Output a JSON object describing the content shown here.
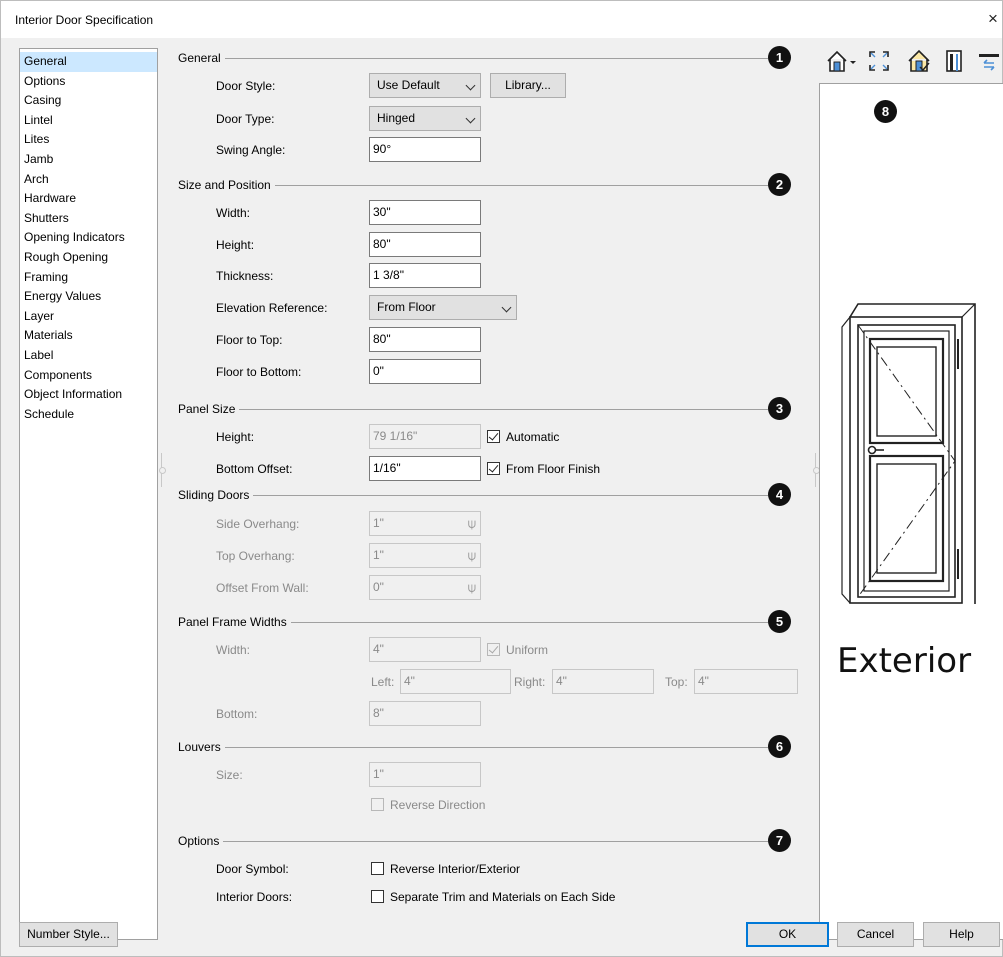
{
  "window": {
    "title": "Interior Door Specification",
    "close_glyph": "×"
  },
  "nav": {
    "items": [
      "General",
      "Options",
      "Casing",
      "Lintel",
      "Lites",
      "Jamb",
      "Arch",
      "Hardware",
      "Shutters",
      "Opening Indicators",
      "Rough Opening",
      "Framing",
      "Energy Values",
      "Layer",
      "Materials",
      "Label",
      "Components",
      "Object Information",
      "Schedule"
    ],
    "selected": "General"
  },
  "general": {
    "title": "General",
    "badge": "1",
    "door_style_label": "Door Style:",
    "door_style_value": "Use Default",
    "library_button": "Library...",
    "door_type_label": "Door Type:",
    "door_type_value": "Hinged",
    "swing_angle_label": "Swing Angle:",
    "swing_angle_value": "90°"
  },
  "size_position": {
    "title": "Size and Position",
    "badge": "2",
    "width_label": "Width:",
    "width_value": "30\"",
    "height_label": "Height:",
    "height_value": "80\"",
    "thickness_label": "Thickness:",
    "thickness_value": "1 3/8\"",
    "elevation_label": "Elevation Reference:",
    "elevation_value": "From Floor",
    "floor_top_label": "Floor to Top:",
    "floor_top_value": "80\"",
    "floor_bottom_label": "Floor to Bottom:",
    "floor_bottom_value": "0\""
  },
  "panel_size": {
    "title": "Panel Size",
    "badge": "3",
    "height_label": "Height:",
    "height_value": "79 1/16\"",
    "automatic_label": "Automatic",
    "automatic_checked": true,
    "bottom_offset_label": "Bottom Offset:",
    "bottom_offset_value": "1/16\"",
    "from_floor_finish_label": "From Floor Finish",
    "from_floor_finish_checked": true
  },
  "sliding_doors": {
    "title": "Sliding Doors",
    "badge": "4",
    "side_overhang_label": "Side Overhang:",
    "side_overhang_value": "1\"",
    "top_overhang_label": "Top Overhang:",
    "top_overhang_value": "1\"",
    "offset_wall_label": "Offset From Wall:",
    "offset_wall_value": "0\""
  },
  "panel_frame_widths": {
    "title": "Panel Frame Widths",
    "badge": "5",
    "width_label": "Width:",
    "width_value": "4\"",
    "uniform_label": "Uniform",
    "uniform_checked": true,
    "left_label": "Left:",
    "left_value": "4\"",
    "right_label": "Right:",
    "right_value": "4\"",
    "top_label": "Top:",
    "top_value": "4\"",
    "bottom_label": "Bottom:",
    "bottom_value": "8\""
  },
  "louvers": {
    "title": "Louvers",
    "badge": "6",
    "size_label": "Size:",
    "size_value": "1\"",
    "reverse_direction_label": "Reverse Direction",
    "reverse_direction_checked": false
  },
  "options": {
    "title": "Options",
    "badge": "7",
    "door_symbol_label": "Door Symbol:",
    "reverse_label": "Reverse Interior/Exterior",
    "reverse_checked": false,
    "interior_doors_label": "Interior Doors:",
    "separate_trim_label": "Separate Trim and Materials on Each Side",
    "separate_trim_checked": false
  },
  "preview": {
    "badge": "8",
    "side_label": "Exterior"
  },
  "footer": {
    "number_style_button": "Number Style...",
    "ok_button": "OK",
    "cancel_button": "Cancel",
    "help_button": "Help"
  },
  "icons": {
    "view_dropdown": "house-view-dropdown-icon",
    "fill_window": "fill-window-icon",
    "render_options": "house-render-icon",
    "wall_preview": "wall-section-icon",
    "swap": "swap-view-icon",
    "lock": "lock-icon"
  },
  "colors": {
    "selected_nav": "#cce8ff",
    "default_button_border": "#0078d7",
    "badge": "#111111"
  }
}
